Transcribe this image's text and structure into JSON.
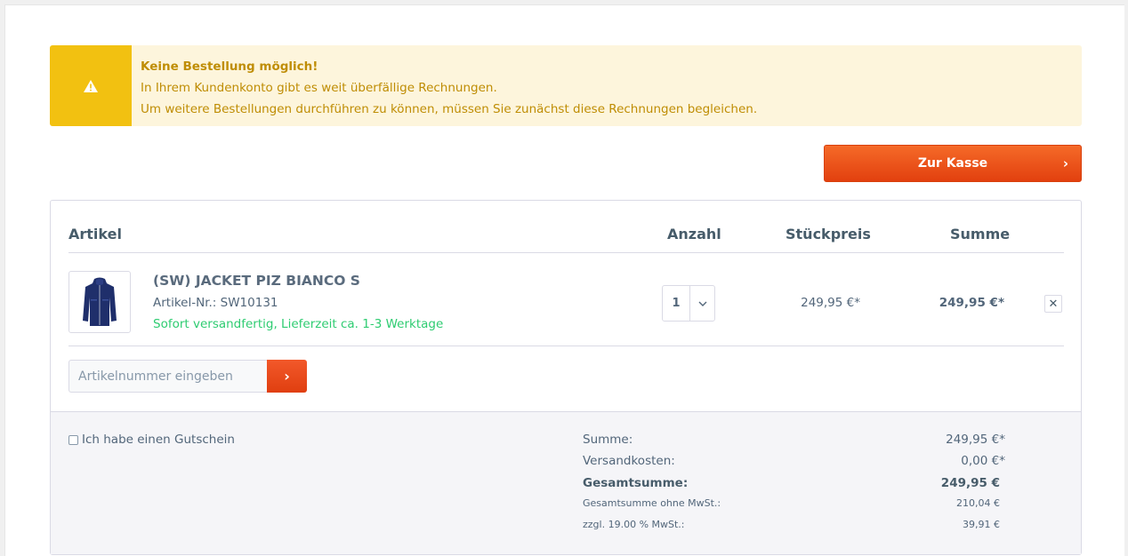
{
  "alert": {
    "title": "Keine Bestellung möglich!",
    "line1": "In Ihrem Kundenkonto gibt es weit überfällige Rechnungen.",
    "line2": "Um weitere Bestellungen durchführen zu können, müssen Sie zunächst diese Rechnungen begleichen.",
    "icon": "warning-icon",
    "color": "#f2c111"
  },
  "checkout": {
    "label": "Zur Kasse",
    "chevron": "›",
    "color": "#e64a19"
  },
  "table": {
    "headers": {
      "article": "Artikel",
      "quantity": "Anzahl",
      "unit_price": "Stückpreis",
      "sum": "Summe"
    }
  },
  "item": {
    "name": "(SW) JACKET PIZ BIANCO S",
    "sku": "Artikel-Nr.: SW10131",
    "delivery": "Sofort versandfertig, Lieferzeit ca. 1-3 Werktage",
    "quantity": "1",
    "unit_price": "249,95 €*",
    "sum": "249,95 €*",
    "remove": "✕",
    "image": "jacket-thumbnail"
  },
  "add_article": {
    "placeholder": "Artikelnummer eingeben",
    "button": "›"
  },
  "voucher": {
    "label": "Ich habe einen Gutschein"
  },
  "totals": {
    "sum_label": "Summe:",
    "sum_value": "249,95 €*",
    "shipping_label": "Versandkosten:",
    "shipping_value": "0,00 €*",
    "total_label": "Gesamtsumme:",
    "total_value": "249,95 €",
    "net_label": "Gesamtsumme ohne MwSt.:",
    "net_value": "210,04 €",
    "vat_label": "zzgl. 19.00 % MwSt.:",
    "vat_value": "39,91 €"
  }
}
